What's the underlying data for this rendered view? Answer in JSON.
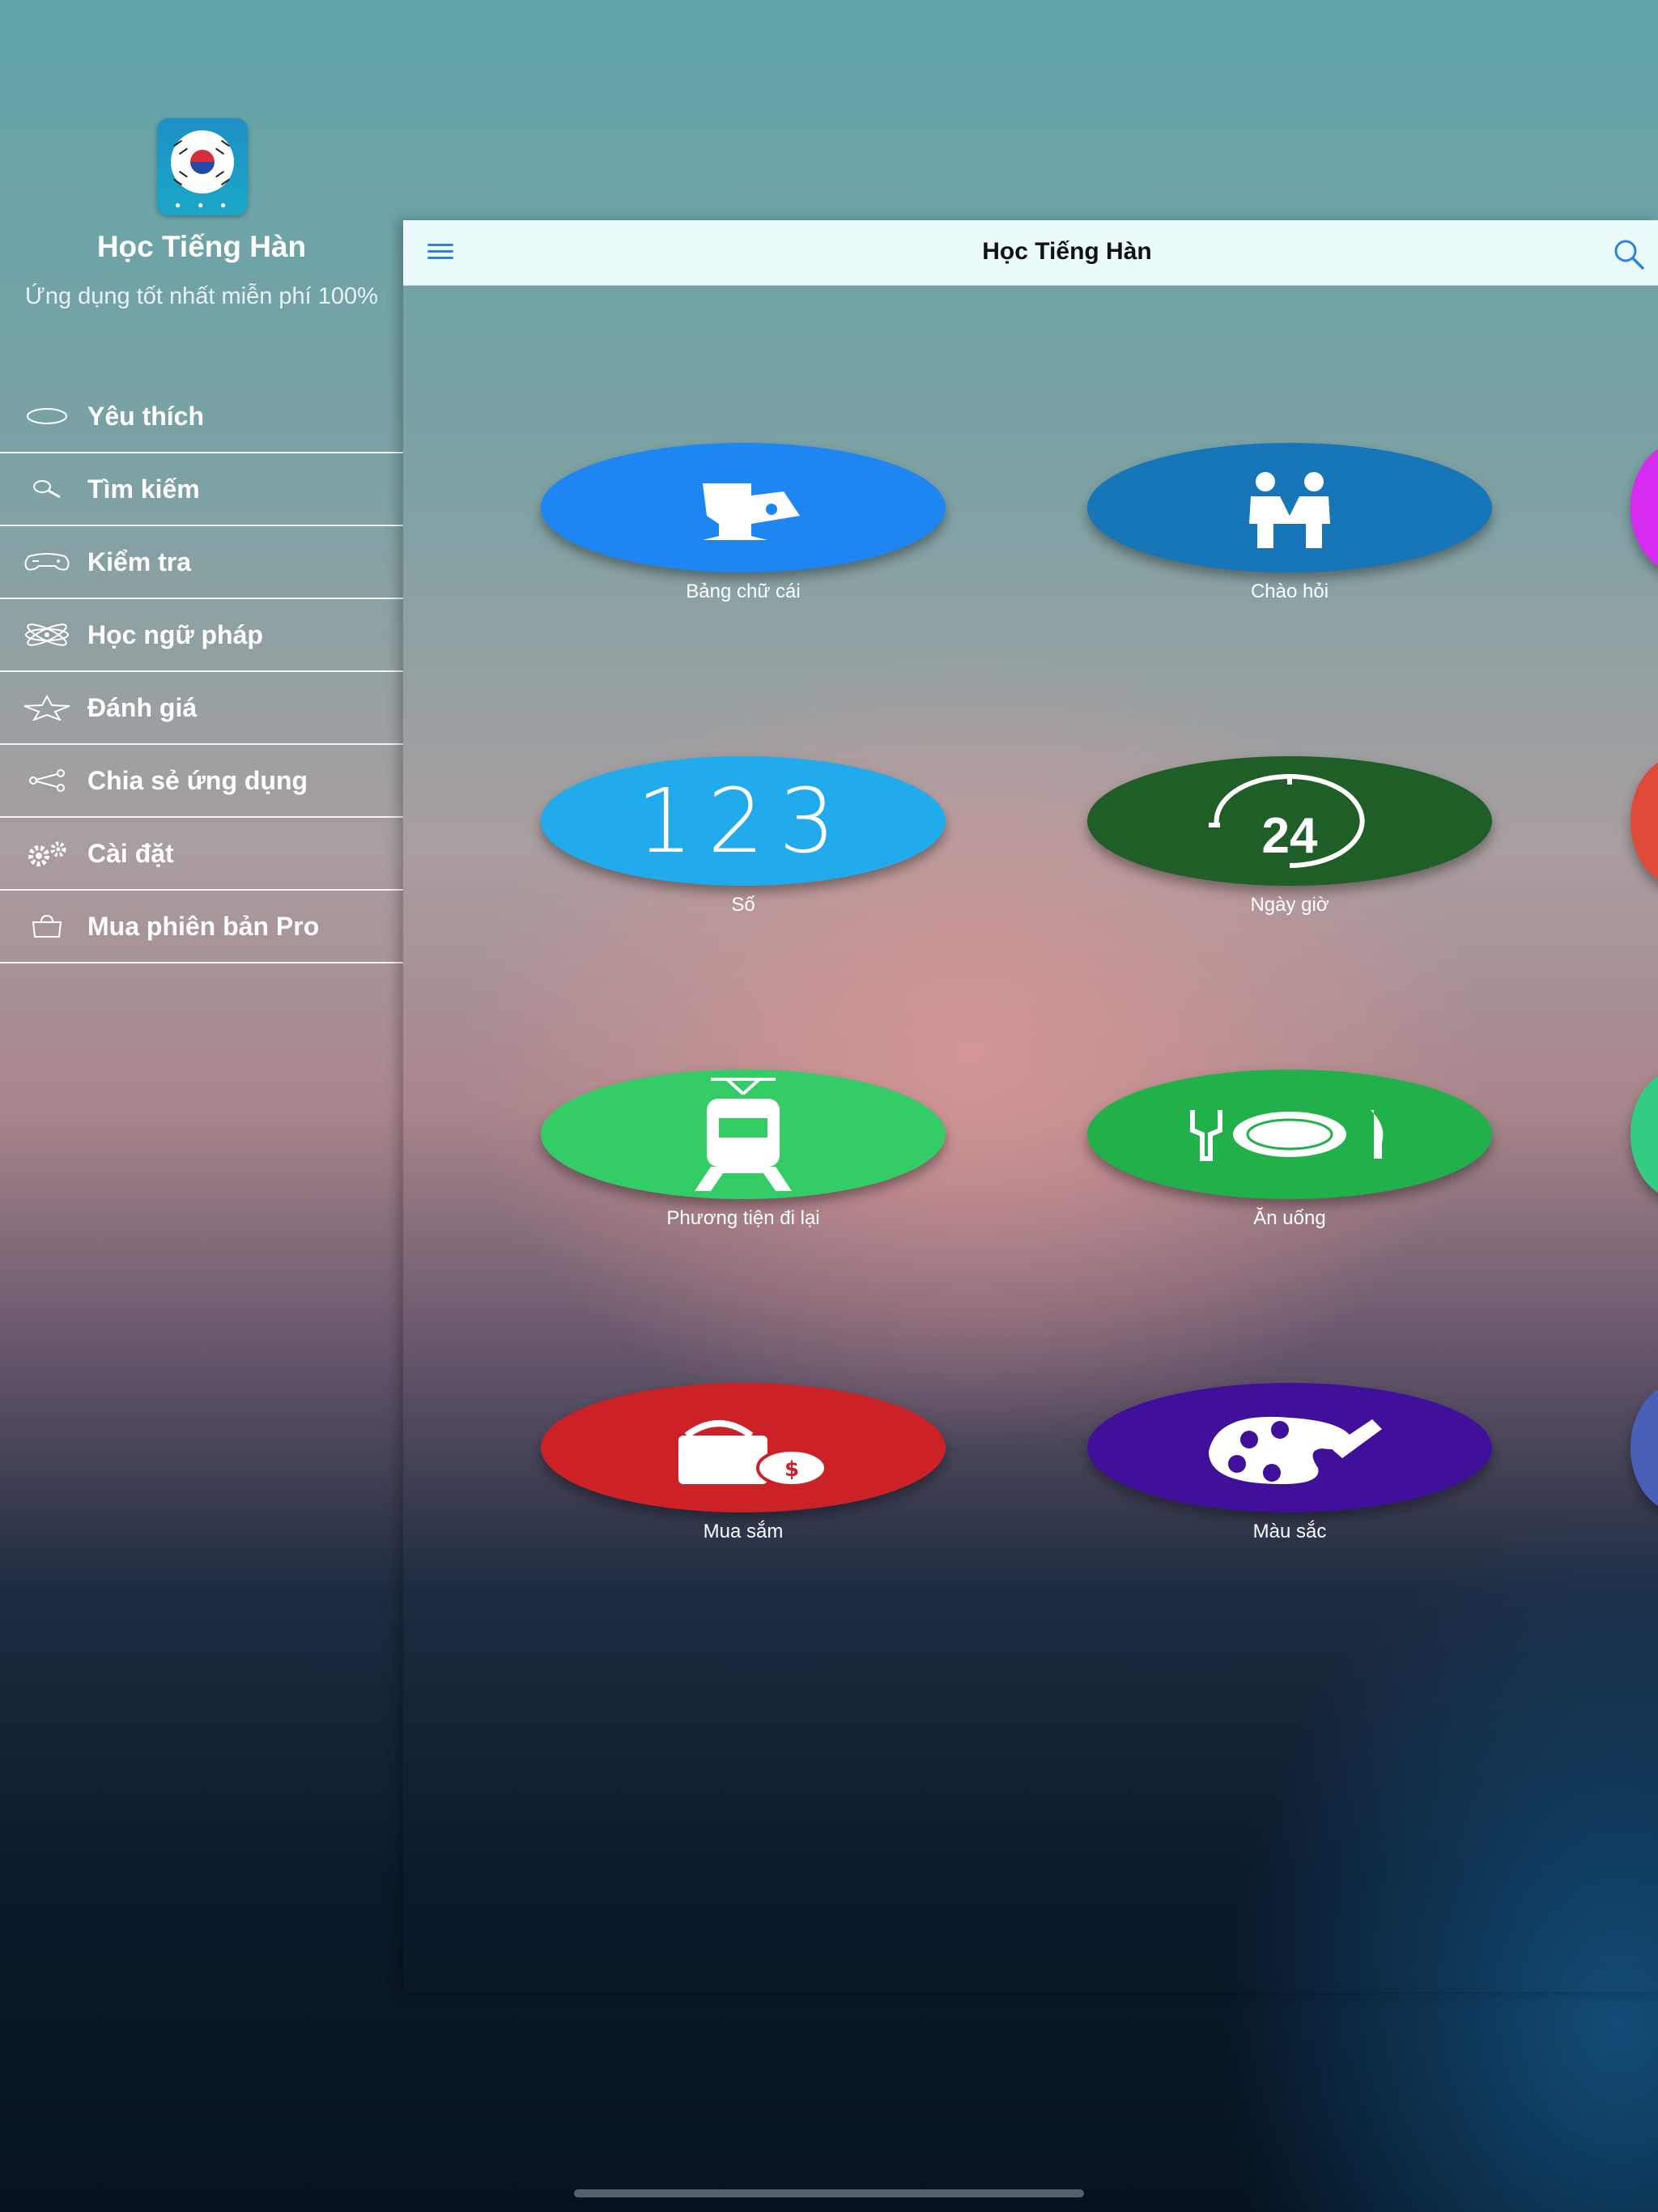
{
  "drawer": {
    "app_title": "Học Tiếng Hàn",
    "subtitle": "Ứng dụng tốt nhất miễn phí 100%",
    "items": [
      {
        "label": "Yêu thích",
        "icon": "heart-icon"
      },
      {
        "label": "Tìm kiếm",
        "icon": "search-icon"
      },
      {
        "label": "Kiểm tra",
        "icon": "gamepad-icon"
      },
      {
        "label": "Học ngữ pháp",
        "icon": "atom-icon"
      },
      {
        "label": "Đánh giá",
        "icon": "star-icon"
      },
      {
        "label": "Chia sẻ ứng dụng",
        "icon": "share-icon"
      },
      {
        "label": "Cài đặt",
        "icon": "gears-icon"
      },
      {
        "label": "Mua phiên bản Pro",
        "icon": "shopping-bag-icon"
      }
    ]
  },
  "navbar": {
    "title": "Học Tiếng Hàn",
    "menu_icon": "hamburger-icon",
    "search_icon": "search-icon"
  },
  "categories": [
    {
      "label": "Bảng chữ cái",
      "color": "#1e86f2",
      "icon": "alphabet-icon"
    },
    {
      "label": "Chào hỏi",
      "color": "#1676b8",
      "icon": "greeting-icon"
    },
    {
      "label": "Số",
      "color": "#21aaec",
      "icon": "numbers-icon",
      "icon_text": "123"
    },
    {
      "label": "Ngày giờ",
      "color": "#1f5e27",
      "icon": "clock-24-icon",
      "icon_text": "24"
    },
    {
      "label": "Phương tiện đi lại",
      "color": "#33cc66",
      "icon": "train-icon"
    },
    {
      "label": "Ăn uống",
      "color": "#22b04a",
      "icon": "dining-icon"
    },
    {
      "label": "Mua sắm",
      "color": "#cc2127",
      "icon": "shopping-icon"
    },
    {
      "label": "Màu sắc",
      "color": "#40109a",
      "icon": "palette-icon"
    }
  ],
  "peek_colors": [
    "#d62cf0",
    "#e04a3a",
    "#33cc80",
    "#4a60b8"
  ]
}
